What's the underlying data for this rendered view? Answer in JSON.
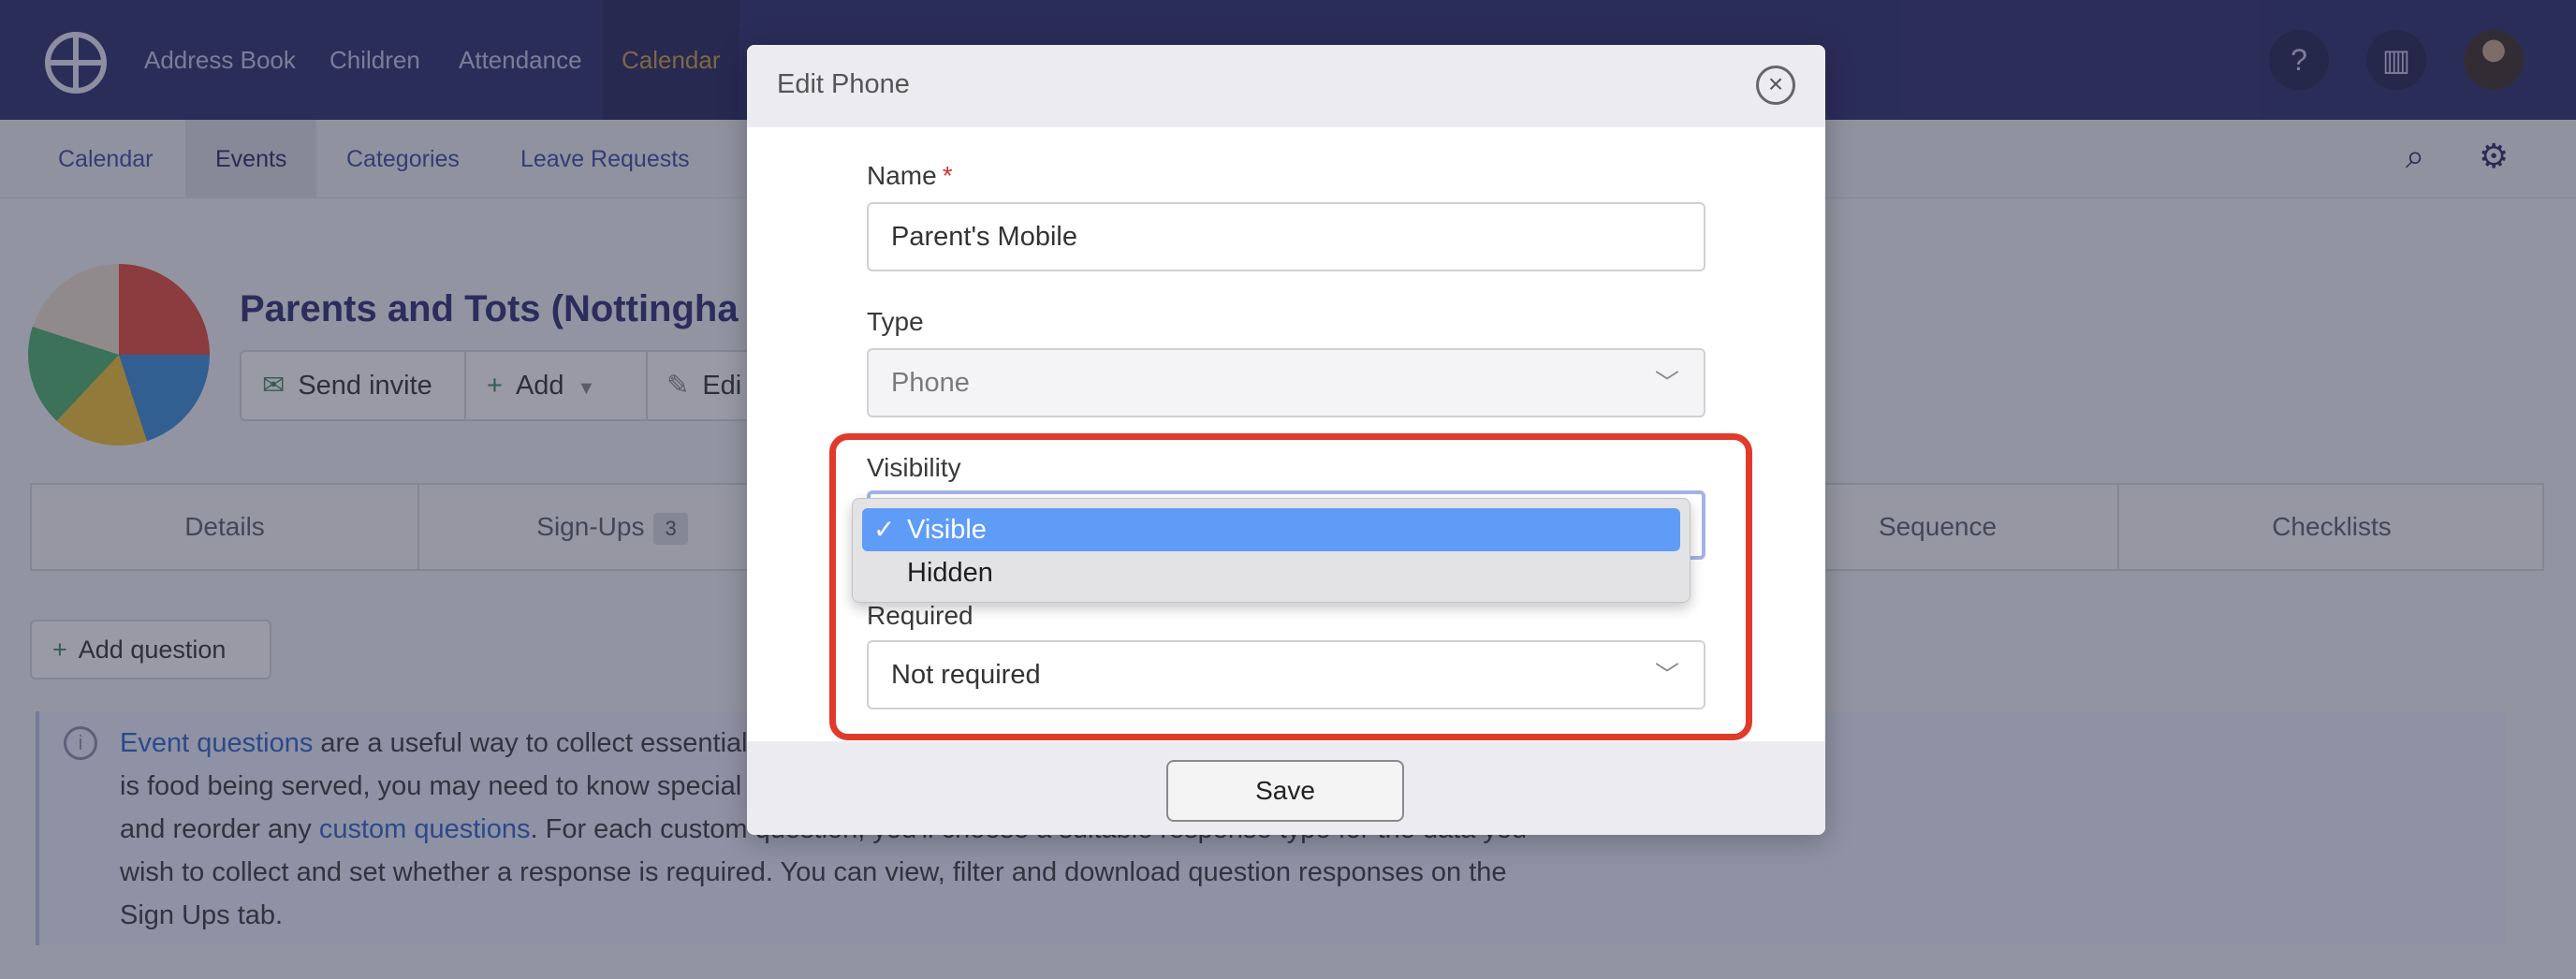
{
  "topnav": {
    "items": [
      "Address Book",
      "Children",
      "Attendance",
      "Calendar"
    ],
    "active": "Calendar",
    "right_icons": [
      "help-icon",
      "building-icon",
      "user-avatar"
    ]
  },
  "subnav": {
    "items": [
      "Calendar",
      "Events",
      "Categories",
      "Leave Requests"
    ],
    "active": "Events",
    "right_icons": [
      "search-icon",
      "settings-icon"
    ]
  },
  "event": {
    "title": "Parents and Tots (Nottingha",
    "actions": {
      "send_invite": "Send invite",
      "add": "Add",
      "edit": "Edi"
    }
  },
  "tabs": [
    {
      "label": "Details"
    },
    {
      "label": "Sign-Ups",
      "badge": "3"
    },
    {
      "label": "Sequence"
    },
    {
      "label": "Checklists"
    }
  ],
  "add_question": "Add question",
  "info": {
    "line1_link": "Event questions",
    "line1_text": " are a useful way to collect essential",
    "line2": "is food being served, you may need to know special",
    "line3_pre": "and reorder any ",
    "line3_link": "custom questions",
    "line3_post": ". For each custom question, you'll choose a suitable response type for the data you",
    "line4": "wish to collect and set whether a response is required. You can view, filter and download question responses on the",
    "line5": "Sign Ups tab."
  },
  "modal": {
    "title": "Edit Phone",
    "fields": {
      "name_label": "Name",
      "name_required": "*",
      "name_value": "Parent's Mobile",
      "type_label": "Type",
      "type_value": "Phone",
      "visibility_label": "Visibility",
      "visibility_options": [
        "Visible",
        "Hidden"
      ],
      "visibility_selected": "Visible",
      "visibility_check": "✓",
      "required_label": "Required",
      "required_value": "Not required"
    },
    "save_label": "Save"
  },
  "colors": {
    "nav_bg": "#2d2f6b",
    "nav_active": "#c9a046",
    "highlight": "#e03a2a",
    "option_selected": "#5f9cf8"
  }
}
